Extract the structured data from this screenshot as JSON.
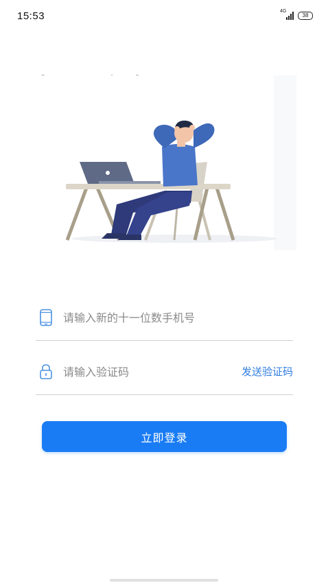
{
  "status_bar": {
    "time": "15:53",
    "network": "4G",
    "battery": "38"
  },
  "headline": "办公更轻松",
  "illustration": {
    "icon": "person-relaxing-at-laptop-illustration"
  },
  "phone_field": {
    "placeholder": "请输入新的十一位数手机号",
    "icon": "phone-icon"
  },
  "code_field": {
    "placeholder": "请输入验证码",
    "icon": "lock-icon",
    "send_label": "发送验证码"
  },
  "login_button": {
    "label": "立即登录"
  },
  "colors": {
    "accent": "#1a7cf5",
    "link": "#2f7de1",
    "icon": "#4a90e2",
    "divider": "#cfcfcf"
  }
}
